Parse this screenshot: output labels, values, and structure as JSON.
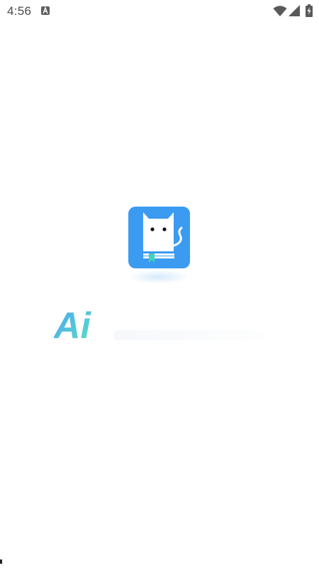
{
  "status_bar": {
    "time": "4:56",
    "notification_icon": "text-a-icon",
    "wifi_icon": "wifi-icon",
    "signal_icon": "cell-signal-icon",
    "battery_icon": "battery-charging-icon"
  },
  "splash": {
    "app_icon": "cat-book-icon",
    "brand_text": "Ai",
    "colors": {
      "logo_bg": "#3b9bf0",
      "brand_gradient_start": "#4aa4f0",
      "brand_gradient_end": "#5ce0c8",
      "bookmark": "#45d1b7"
    }
  }
}
